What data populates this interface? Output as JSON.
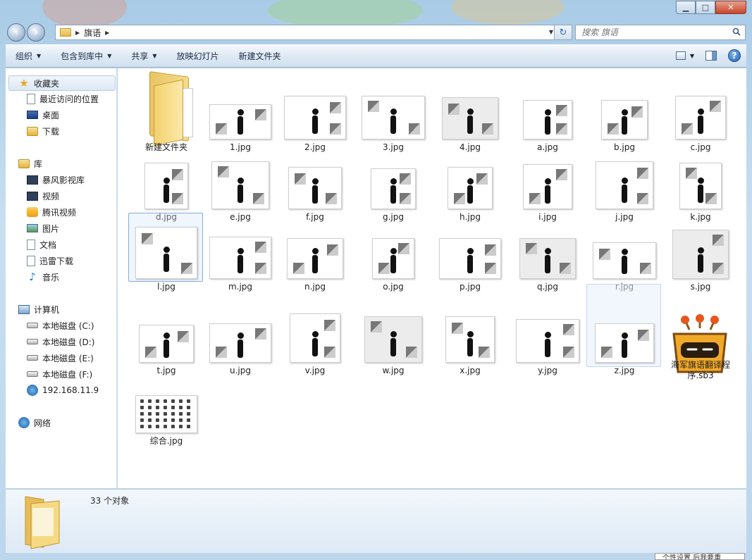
{
  "window": {
    "caption": {
      "minimize": "▁",
      "maximize": "□",
      "close": "✕"
    }
  },
  "address": {
    "path": [
      "旗语"
    ],
    "search_placeholder": "搜索 旗语"
  },
  "toolbar": {
    "organize": "组织",
    "include_library": "包含到库中",
    "share": "共享",
    "slideshow": "放映幻灯片",
    "new_folder": "新建文件夹"
  },
  "navpane": {
    "favorites": {
      "label": "收藏夹",
      "items": [
        "最近访问的位置",
        "桌面",
        "下载"
      ]
    },
    "libraries": {
      "label": "库",
      "items": [
        "暴风影视库",
        "视频",
        "腾讯视频",
        "图片",
        "文档",
        "迅雷下载",
        "音乐"
      ]
    },
    "computer": {
      "label": "计算机",
      "items": [
        "本地磁盘 (C:)",
        "本地磁盘 (D:)",
        "本地磁盘 (E:)",
        "本地磁盘 (F:)",
        "192.168.11.9"
      ]
    },
    "network": {
      "label": "网络"
    }
  },
  "files": [
    "新建文件夹",
    "1.jpg",
    "2.jpg",
    "3.jpg",
    "4.jpg",
    "a.jpg",
    "b.jpg",
    "c.jpg",
    "d.jpg",
    "e.jpg",
    "f.jpg",
    "g.jpg",
    "h.jpg",
    "i.jpg",
    "j.jpg",
    "k.jpg",
    "l.jpg",
    "m.jpg",
    "n.jpg",
    "o.jpg",
    "p.jpg",
    "q.jpg",
    "r.jpg",
    "s.jpg",
    "t.jpg",
    "u.jpg",
    "v.jpg",
    "w.jpg",
    "x.jpg",
    "y.jpg",
    "z.jpg",
    "海军旗语翻译程序.sb3",
    "综合.jpg"
  ],
  "details": {
    "count": "33 个对象"
  },
  "taskbar_tip": "个性设置  后我要重"
}
